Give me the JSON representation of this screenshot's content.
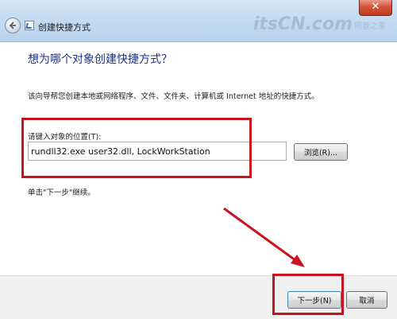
{
  "window": {
    "title": "创建快捷方式",
    "close_glyph": "✕"
  },
  "watermark": {
    "logo": "itsCN.com",
    "sub": "网管之家"
  },
  "main": {
    "heading": "想为哪个对象创建快捷方式？",
    "description": "该向导帮您创建本地或网络程序、文件、文件夹、计算机或 Internet 地址的快捷方式。",
    "location_label": "请键入对象的位置(T):",
    "location_value": "rundll32.exe user32.dll, LockWorkStation",
    "browse_label": "浏览(R)...",
    "hint": "单击\"下一步\"继续。"
  },
  "footer": {
    "next_label": "下一步(N)",
    "cancel_label": "取消"
  },
  "annotation": {
    "color": "#c8141e"
  },
  "icons": {
    "back": "back-arrow-icon",
    "dialog": "shortcut-icon",
    "close": "close-icon"
  }
}
